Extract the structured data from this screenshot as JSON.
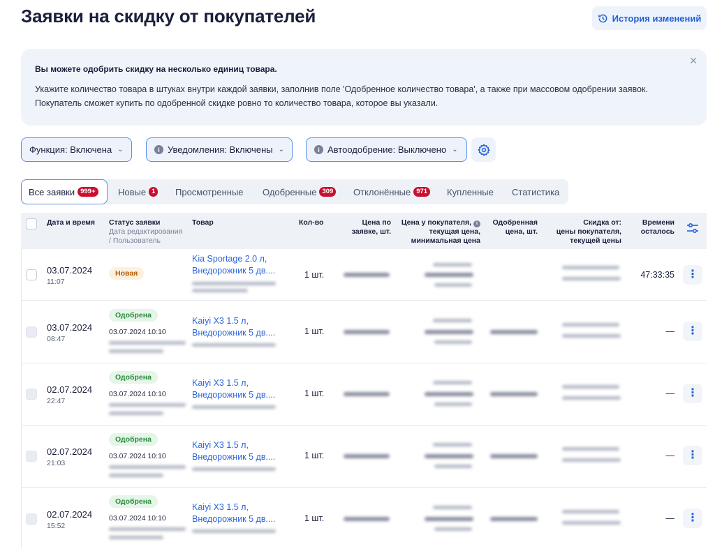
{
  "header": {
    "title": "Заявки на скидку от покупателей",
    "history_label": "История изменений"
  },
  "banner": {
    "title": "Вы можете одобрить скидку на несколько единиц товара.",
    "line1": "Укажите количество товара в штуках внутри каждой заявки, заполнив поле 'Одобренное количество товара', а также при массовом одобрении заявок.",
    "line2": "Покупатель сможет купить по одобренной скидке ровно то количество товара, которое вы указали.",
    "close": "×"
  },
  "filters": {
    "function_label": "Функция: Включена",
    "notifications_label": "Уведомления: Включены",
    "autoapprove_label": "Автоодобрение: Выключено",
    "info_glyph": "i",
    "chevron": "⌄"
  },
  "tabs": [
    {
      "label": "Все заявки",
      "badge": "999+"
    },
    {
      "label": "Новые",
      "badge": "1"
    },
    {
      "label": "Просмотренные",
      "badge": ""
    },
    {
      "label": "Одобренные",
      "badge": "309"
    },
    {
      "label": "Отклонённые",
      "badge": "971"
    },
    {
      "label": "Купленные",
      "badge": ""
    },
    {
      "label": "Статистика",
      "badge": ""
    }
  ],
  "table": {
    "headers": {
      "date": "Дата и время",
      "status": "Статус заявки",
      "status_sub1": "Дата редактирования",
      "status_sub2": "/ Пользователь",
      "product": "Товар",
      "qty": "Кол-во",
      "req_price_1": "Цена по",
      "req_price_2": "заявке, шт.",
      "buyer_price_1": "Цена у покупателя,",
      "buyer_price_2": "текущая цена,",
      "buyer_price_3": "минимальная цена",
      "approved_price_1": "Одобренная",
      "approved_price_2": "цена, шт.",
      "discount_1": "Скидка от:",
      "discount_2": "цены покупателя,",
      "discount_3": "текущей цены",
      "remain_1": "Времени",
      "remain_2": "осталось"
    },
    "rows": [
      {
        "date": "03.07.2024",
        "time": "11:07",
        "status": "Новая",
        "status_kind": "new",
        "edit": "",
        "product_1": "Kia Sportage 2.0 л,",
        "product_2": "Внедорожник 5 дв....",
        "qty": "1 шт.",
        "remain": "47:33:35"
      },
      {
        "date": "03.07.2024",
        "time": "08:47",
        "status": "Одобрена",
        "status_kind": "ok",
        "edit": "03.07.2024 10:10",
        "product_1": "Kaiyi X3 1.5 л,",
        "product_2": "Внедорожник 5 дв....",
        "qty": "1 шт.",
        "remain": "—"
      },
      {
        "date": "02.07.2024",
        "time": "22:47",
        "status": "Одобрена",
        "status_kind": "ok",
        "edit": "03.07.2024 10:10",
        "product_1": "Kaiyi X3 1.5 л,",
        "product_2": "Внедорожник 5 дв....",
        "qty": "1 шт.",
        "remain": "—"
      },
      {
        "date": "02.07.2024",
        "time": "21:03",
        "status": "Одобрена",
        "status_kind": "ok",
        "edit": "03.07.2024 10:10",
        "product_1": "Kaiyi X3 1.5 л,",
        "product_2": "Внедорожник 5 дв....",
        "qty": "1 шт.",
        "remain": "—"
      },
      {
        "date": "02.07.2024",
        "time": "15:52",
        "status": "Одобрена",
        "status_kind": "ok",
        "edit": "03.07.2024 10:10",
        "product_1": "Kaiyi X3 1.5 л,",
        "product_2": "Внедорожник 5 дв....",
        "qty": "1 шт.",
        "remain": "—"
      }
    ],
    "menu_glyph": "⋮"
  },
  "icons": {
    "history": "history-icon",
    "settings": "gear-icon",
    "columns": "sliders-icon",
    "close": "close-icon"
  },
  "colors": {
    "accent": "#1e5fd8",
    "badge_red": "#c8102e",
    "status_new_bg": "#fdf0de",
    "status_ok_bg": "#e5f5e8"
  }
}
